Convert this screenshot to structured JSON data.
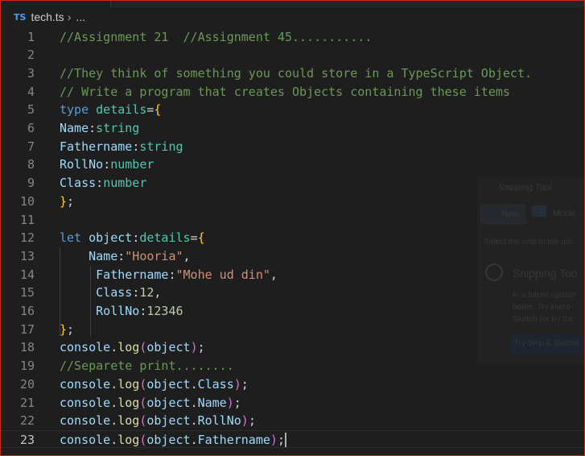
{
  "breadcrumb": {
    "lang_badge": "TS",
    "file": "tech.ts",
    "separator": "›",
    "more": "..."
  },
  "editor": {
    "current_line": 23,
    "lines": [
      {
        "n": "1",
        "tokens": [
          [
            "cm",
            "//Assignment 21  //Assignment 45..........."
          ]
        ]
      },
      {
        "n": "2",
        "tokens": []
      },
      {
        "n": "3",
        "tokens": [
          [
            "cm",
            "//They think of something you could store in a TypeScript Object."
          ]
        ]
      },
      {
        "n": "4",
        "tokens": [
          [
            "cm",
            "// Write a program that creates Objects containing these items"
          ]
        ]
      },
      {
        "n": "5",
        "tokens": [
          [
            "kw",
            "type"
          ],
          [
            "pu",
            " "
          ],
          [
            "ty",
            "details"
          ],
          [
            "pu",
            "="
          ],
          [
            "br",
            "{"
          ]
        ]
      },
      {
        "n": "6",
        "tokens": [
          [
            "pr",
            "Name"
          ],
          [
            "pu",
            ":"
          ],
          [
            "ty",
            "string"
          ]
        ]
      },
      {
        "n": "7",
        "tokens": [
          [
            "pr",
            "Fathername"
          ],
          [
            "pu",
            ":"
          ],
          [
            "ty",
            "string"
          ]
        ]
      },
      {
        "n": "8",
        "tokens": [
          [
            "pr",
            "RollNo"
          ],
          [
            "pu",
            ":"
          ],
          [
            "ty",
            "number"
          ]
        ]
      },
      {
        "n": "9",
        "tokens": [
          [
            "pr",
            "Class"
          ],
          [
            "pu",
            ":"
          ],
          [
            "ty",
            "number"
          ]
        ]
      },
      {
        "n": "10",
        "tokens": [
          [
            "br",
            "}"
          ],
          [
            "pu",
            ";"
          ]
        ]
      },
      {
        "n": "11",
        "tokens": []
      },
      {
        "n": "12",
        "tokens": [
          [
            "kw",
            "let"
          ],
          [
            "pu",
            " "
          ],
          [
            "pr",
            "object"
          ],
          [
            "pu",
            ":"
          ],
          [
            "ty",
            "details"
          ],
          [
            "pu",
            "="
          ],
          [
            "br",
            "{"
          ]
        ]
      },
      {
        "n": "13",
        "tokens": [
          [
            "pu",
            "    "
          ],
          [
            "pr",
            "Name"
          ],
          [
            "pu",
            ":"
          ],
          [
            "st",
            "\"Hooria\""
          ],
          [
            "pu",
            ","
          ]
        ]
      },
      {
        "n": "14",
        "tokens": [
          [
            "pu",
            "     "
          ],
          [
            "pr",
            "Fathername"
          ],
          [
            "pu",
            ":"
          ],
          [
            "st",
            "\"Mohe ud din\""
          ],
          [
            "pu",
            ","
          ]
        ]
      },
      {
        "n": "15",
        "tokens": [
          [
            "pu",
            "     "
          ],
          [
            "pr",
            "Class"
          ],
          [
            "pu",
            ":"
          ],
          [
            "nu",
            "12"
          ],
          [
            "pu",
            ","
          ]
        ]
      },
      {
        "n": "16",
        "tokens": [
          [
            "pu",
            "     "
          ],
          [
            "pr",
            "RollNo"
          ],
          [
            "pu",
            ":"
          ],
          [
            "nu",
            "12346"
          ]
        ]
      },
      {
        "n": "17",
        "tokens": [
          [
            "br",
            "}"
          ],
          [
            "pu",
            ";"
          ]
        ]
      },
      {
        "n": "18",
        "tokens": [
          [
            "pr",
            "console"
          ],
          [
            "pu",
            "."
          ],
          [
            "fn",
            "log"
          ],
          [
            "br2",
            "("
          ],
          [
            "pr",
            "object"
          ],
          [
            "br2",
            ")"
          ],
          [
            "pu",
            ";"
          ]
        ]
      },
      {
        "n": "19",
        "tokens": [
          [
            "cm",
            "//Separete print........"
          ]
        ]
      },
      {
        "n": "20",
        "tokens": [
          [
            "pr",
            "console"
          ],
          [
            "pu",
            "."
          ],
          [
            "fn",
            "log"
          ],
          [
            "br2",
            "("
          ],
          [
            "pr",
            "object"
          ],
          [
            "pu",
            "."
          ],
          [
            "pr",
            "Class"
          ],
          [
            "br2",
            ")"
          ],
          [
            "pu",
            ";"
          ]
        ]
      },
      {
        "n": "21",
        "tokens": [
          [
            "pr",
            "console"
          ],
          [
            "pu",
            "."
          ],
          [
            "fn",
            "log"
          ],
          [
            "br2",
            "("
          ],
          [
            "pr",
            "object"
          ],
          [
            "pu",
            "."
          ],
          [
            "pr",
            "Name"
          ],
          [
            "br2",
            ")"
          ],
          [
            "pu",
            ";"
          ]
        ]
      },
      {
        "n": "22",
        "tokens": [
          [
            "pr",
            "console"
          ],
          [
            "pu",
            "."
          ],
          [
            "fn",
            "log"
          ],
          [
            "br2",
            "("
          ],
          [
            "pr",
            "object"
          ],
          [
            "pu",
            "."
          ],
          [
            "pr",
            "RollNo"
          ],
          [
            "br2",
            ")"
          ],
          [
            "pu",
            ";"
          ]
        ]
      },
      {
        "n": "23",
        "tokens": [
          [
            "pr",
            "console"
          ],
          [
            "pu",
            "."
          ],
          [
            "fn",
            "log"
          ],
          [
            "br2",
            "("
          ],
          [
            "pr",
            "object"
          ],
          [
            "pu",
            "."
          ],
          [
            "pr",
            "Fathername"
          ],
          [
            "br2",
            ")"
          ],
          [
            "pu",
            ";"
          ]
        ]
      }
    ]
  },
  "snipping_overlay": {
    "title": "Snipping Tool",
    "new_label": "New",
    "mode_label": "Mode",
    "instruction": "Select the snip mode usi",
    "heading": "Snipping Too",
    "body_lines": [
      "In a future update",
      "home. Try impro",
      "Sketch (or try the"
    ],
    "try_label": "Try Snip & Sketch"
  }
}
